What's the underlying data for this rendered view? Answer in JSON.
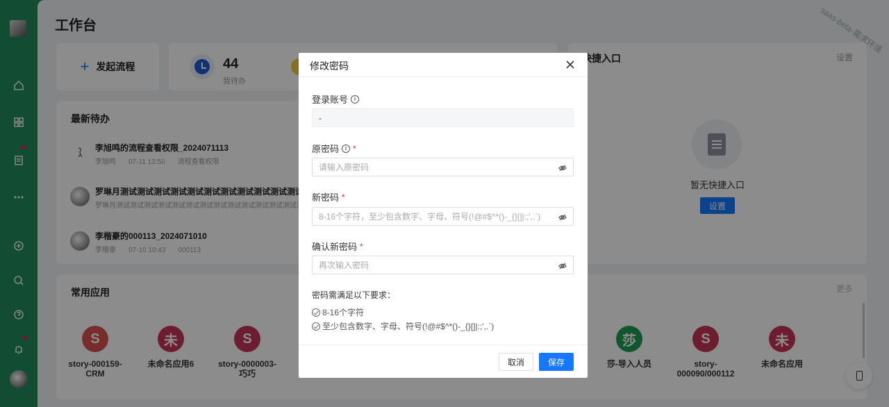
{
  "page": {
    "title": "工作台",
    "watermark": "saas-beta-需求环境"
  },
  "quick_actions": {
    "start_process_label": "发起流程"
  },
  "stats": {
    "pending_count": "44",
    "pending_label": "我待办"
  },
  "todo": {
    "title": "最新待办",
    "items": [
      {
        "title": "李旭鸣的流程查看权限_2024071113",
        "meta": [
          "李旭鸣",
          "07-11 13:50",
          "流程查看权限"
        ]
      },
      {
        "title": "罗琳月测试测试测试测试测试测试测试测试测试测试测试测试",
        "meta": [
          "罗琳月测试测试测试测试测试测试测试测试测试测试测试测试测试测试"
        ]
      },
      {
        "title": "李楷豪的000113_2024071010",
        "meta": [
          "李楷豪",
          "07-10 10:43",
          "000113"
        ]
      }
    ]
  },
  "quick_entry": {
    "title": "快捷入口",
    "setting": "设置",
    "empty_text": "暂无快捷入口",
    "setting_button": "设置"
  },
  "apps": {
    "title": "常用应用",
    "more": "更多",
    "items": [
      {
        "icon_text": "S",
        "name": "story-000159-CRM",
        "color": "#d9534f"
      },
      {
        "icon_text": "未",
        "name": "未命名应用6",
        "color": "#c9365a"
      },
      {
        "icon_text": "S",
        "name": "story-0000003-巧巧",
        "color": "#c9365a"
      },
      {
        "icon_text": "莎",
        "name": "莎-导入人员",
        "color": "#1f9d55"
      },
      {
        "icon_text": "S",
        "name": "story-000090/000112",
        "color": "#c9365a"
      },
      {
        "icon_text": "未",
        "name": "未命名应用",
        "color": "#c9365a"
      }
    ]
  },
  "modal": {
    "title": "修改密码",
    "account_label": "登录账号",
    "account_value": "-",
    "old_label": "原密码",
    "old_placeholder": "请输入原密码",
    "new_label": "新密码",
    "new_placeholder": "8-16个字符，至少包含数字、字母、符号(!@#$^*()-_{}[]|:;',.`)",
    "confirm_label": "确认新密码",
    "confirm_placeholder": "再次输入密码",
    "rules_title": "密码需满足以下要求：",
    "rule_1": "8-16个字符",
    "rule_2": "至少包含数字、字母、符号(!@#$^*()-_{}[]|:;',.`)",
    "required_mark": "*",
    "cancel_label": "取消",
    "save_label": "保存"
  },
  "colors": {
    "brand_green": "#1f8a5d",
    "primary": "#1677ff",
    "required": "#f5222d"
  }
}
